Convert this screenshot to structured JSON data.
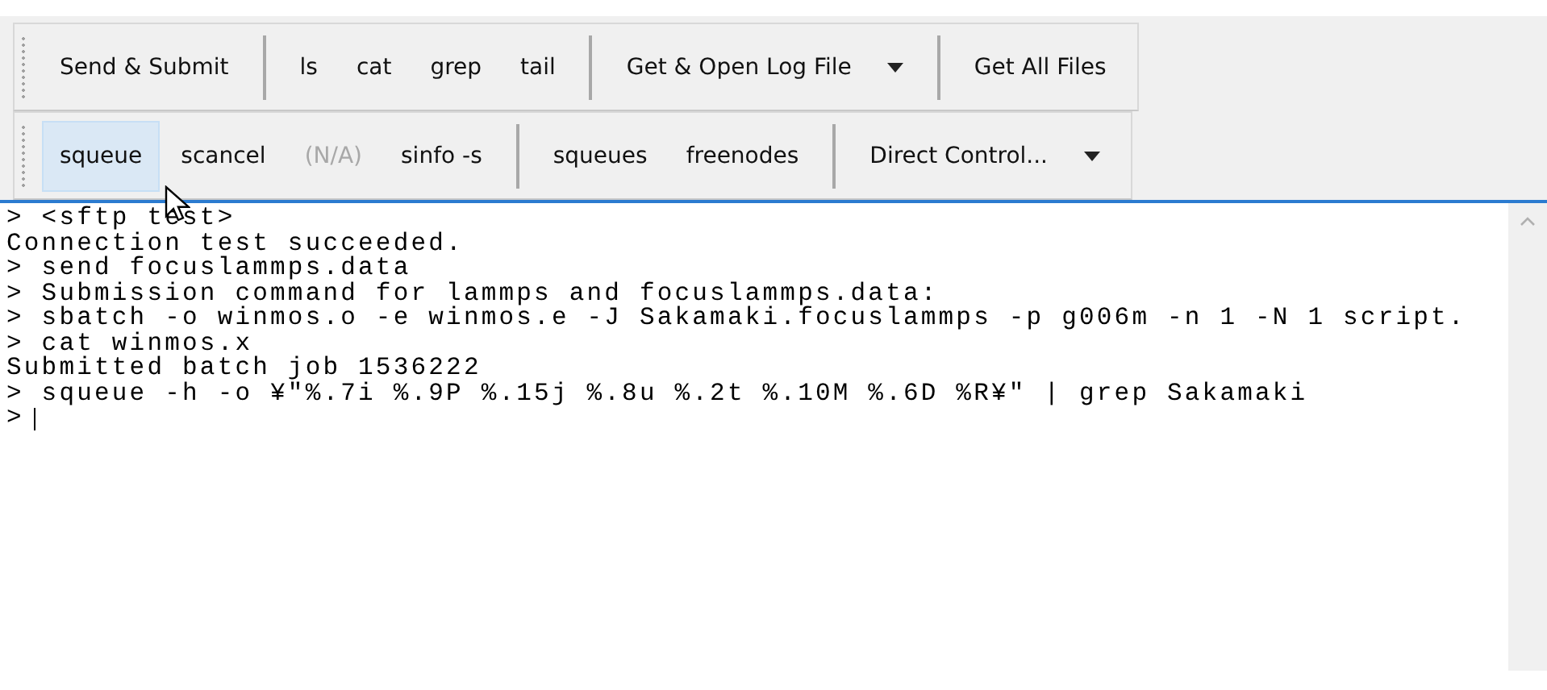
{
  "toolbars": [
    {
      "groups": [
        {
          "items": [
            {
              "label": "Send & Submit",
              "kind": "button",
              "selected": false,
              "disabled": false
            }
          ]
        },
        {
          "items": [
            {
              "label": "ls",
              "kind": "button",
              "selected": false,
              "disabled": false
            },
            {
              "label": "cat",
              "kind": "button",
              "selected": false,
              "disabled": false
            },
            {
              "label": "grep",
              "kind": "button",
              "selected": false,
              "disabled": false
            },
            {
              "label": "tail",
              "kind": "button",
              "selected": false,
              "disabled": false
            }
          ]
        },
        {
          "items": [
            {
              "label": "Get & Open Log File",
              "kind": "dropdown",
              "selected": false,
              "disabled": false
            }
          ]
        },
        {
          "items": [
            {
              "label": "Get All Files",
              "kind": "button",
              "selected": false,
              "disabled": false
            }
          ]
        }
      ]
    },
    {
      "groups": [
        {
          "items": [
            {
              "label": "squeue",
              "kind": "button",
              "selected": true,
              "disabled": false
            },
            {
              "label": "scancel",
              "kind": "button",
              "selected": false,
              "disabled": false
            },
            {
              "label": "(N/A)",
              "kind": "button",
              "selected": false,
              "disabled": true
            },
            {
              "label": "sinfo -s",
              "kind": "button",
              "selected": false,
              "disabled": false
            }
          ]
        },
        {
          "items": [
            {
              "label": "squeues",
              "kind": "button",
              "selected": false,
              "disabled": false
            },
            {
              "label": "freenodes",
              "kind": "button",
              "selected": false,
              "disabled": false
            }
          ]
        },
        {
          "items": [
            {
              "label": "Direct Control...",
              "kind": "dropdown",
              "selected": false,
              "disabled": false
            }
          ]
        }
      ]
    }
  ],
  "console": {
    "lines": [
      "> <sftp test>",
      "Connection test succeeded.",
      "> send focuslammps.data",
      "> Submission command for lammps and focuslammps.data:",
      "> sbatch -o winmos.o -e winmos.e -J Sakamaki.focuslammps -p g006m -n 1 -N 1 script.",
      "> cat winmos.x",
      "Submitted batch job 1536222",
      "> squeue -h -o ¥\"%.7i %.9P %.15j %.8u %.2t %.10M %.6D %R¥\" | grep Sakamaki"
    ],
    "prompt": ">"
  }
}
